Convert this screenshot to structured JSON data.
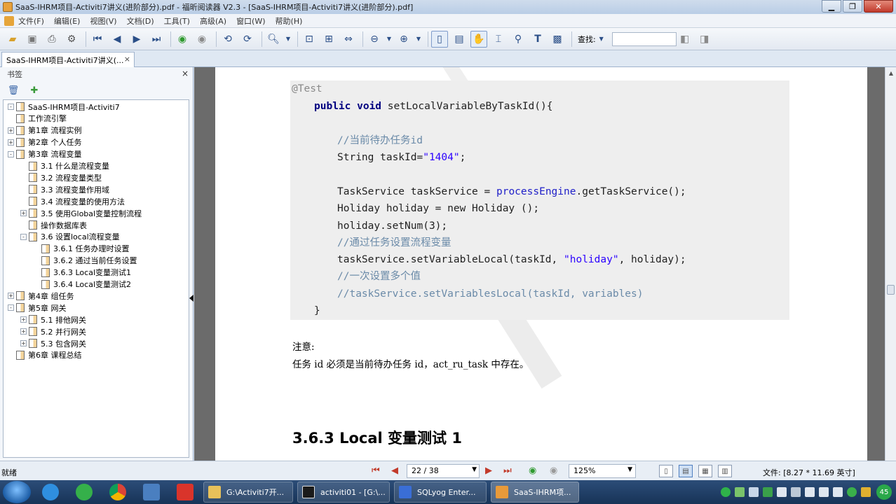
{
  "window": {
    "title": "SaaS-IHRM项目-Activiti7讲义(进阶部分).pdf - 福昕阅读器 V2.3 - [SaaS-IHRM项目-Activiti7讲义(进阶部分).pdf]"
  },
  "menu": [
    "文件(F)",
    "编辑(E)",
    "视图(V)",
    "文档(D)",
    "工具(T)",
    "高级(A)",
    "窗口(W)",
    "帮助(H)"
  ],
  "toolbar": {
    "search_label": "查找:"
  },
  "tab": {
    "label": "SaaS-IHRM项目-Activiti7讲义(...",
    "close": "×"
  },
  "sidebar": {
    "title": "书签",
    "close": "×",
    "items": [
      {
        "label": "SaaS-IHRM项目-Activiti7",
        "level": 0,
        "expander": "-"
      },
      {
        "label": "工作流引擎",
        "level": 0,
        "expander": ""
      },
      {
        "label": "第1章 流程实例",
        "level": 0,
        "expander": "+"
      },
      {
        "label": "第2章 个人任务",
        "level": 0,
        "expander": "+"
      },
      {
        "label": "第3章 流程变量",
        "level": 0,
        "expander": "-"
      },
      {
        "label": "3.1 什么是流程变量",
        "level": 1,
        "expander": ""
      },
      {
        "label": "3.2 流程变量类型",
        "level": 1,
        "expander": ""
      },
      {
        "label": "3.3 流程变量作用域",
        "level": 1,
        "expander": ""
      },
      {
        "label": "3.4 流程变量的使用方法",
        "level": 1,
        "expander": ""
      },
      {
        "label": "3.5 使用Global变量控制流程",
        "level": 1,
        "expander": "+"
      },
      {
        "label": "操作数据库表",
        "level": 1,
        "expander": ""
      },
      {
        "label": "3.6 设置local流程变量",
        "level": 1,
        "expander": "-"
      },
      {
        "label": "3.6.1 任务办理时设置",
        "level": 2,
        "expander": ""
      },
      {
        "label": "3.6.2 通过当前任务设置",
        "level": 2,
        "expander": ""
      },
      {
        "label": "3.6.3 Local变量测试1",
        "level": 2,
        "expander": ""
      },
      {
        "label": "3.6.4 Local变量测试2",
        "level": 2,
        "expander": ""
      },
      {
        "label": "第4章 组任务",
        "level": 0,
        "expander": "+"
      },
      {
        "label": "第5章 网关",
        "level": 0,
        "expander": "-"
      },
      {
        "label": "5.1 排他网关",
        "level": 1,
        "expander": "+"
      },
      {
        "label": "5.2 并行网关",
        "level": 1,
        "expander": "+"
      },
      {
        "label": "5.3 包含网关",
        "level": 1,
        "expander": "+"
      },
      {
        "label": "第6章 课程总结",
        "level": 0,
        "expander": ""
      }
    ]
  },
  "document": {
    "code": {
      "annotation": "@Test",
      "method_kw": "public void ",
      "method_sig": "setLocalVariableByTaskId(){",
      "c1": "//当前待办任务id",
      "l_task_a": "String taskId=",
      "l_task_str": "\"1404\"",
      "l_task_b": ";",
      "l_ts_a": "TaskService taskService = ",
      "l_ts_field": "processEngine",
      "l_ts_b": ".getTaskService();",
      "l_hol": "Holiday holiday = new Holiday ();",
      "l_num": "holiday.setNum(3);",
      "c2": "//通过任务设置流程变量",
      "l_set_a": "taskService.setVariableLocal(taskId, ",
      "l_set_str": "\"holiday\"",
      "l_set_b": ", holiday);",
      "c3": "//一次设置多个值",
      "c4": "//taskService.setVariablesLocal(taskId, variables)",
      "close_brace": "}"
    },
    "note_label": "注意:",
    "note_text": "任务 id 必须是当前待办任务 id，act_ru_task 中存在。",
    "heading": "3.6.3 Local 变量测试 1"
  },
  "status": {
    "ready": "就绪",
    "page": "22 / 38",
    "zoom": "125%",
    "file_size": "文件: [8.27 * 11.69 英寸]"
  },
  "taskbar": {
    "items": [
      {
        "label": "G:\\Activiti7开...",
        "icon_color": "#e8c15a"
      },
      {
        "label": "activiti01 - [G:\\...",
        "icon_color": "#1b1b1b"
      },
      {
        "label": "SQLyog Enter...",
        "icon_color": "#3a6ed6"
      },
      {
        "label": "SaaS-IHRM项...",
        "icon_color": "#e89a3a"
      }
    ],
    "badge": "45"
  }
}
